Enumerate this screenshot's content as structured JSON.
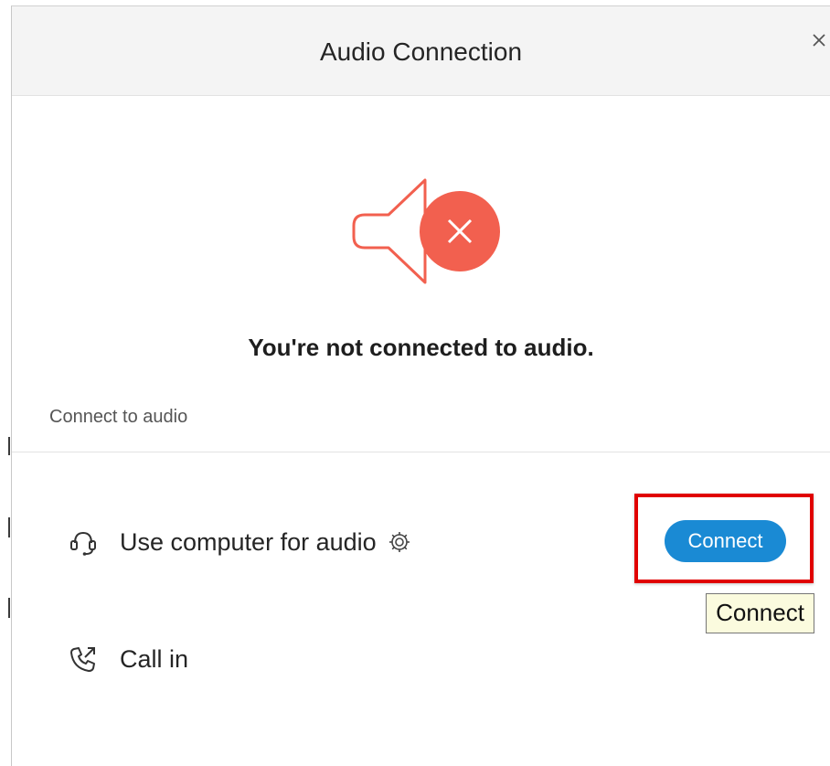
{
  "dialog": {
    "title": "Audio Connection",
    "close_icon": "close-icon"
  },
  "status": {
    "icon": "speaker-muted-icon",
    "message": "You're not connected to audio.",
    "colors": {
      "error_red": "#f2604f",
      "white": "#ffffff"
    }
  },
  "connect_section": {
    "label": "Connect to audio",
    "options": [
      {
        "icon": "headset-icon",
        "label": "Use computer for audio",
        "settings_icon": "gear-icon",
        "button_label": "Connect"
      },
      {
        "icon": "phone-call-icon",
        "label": "Call in"
      }
    ]
  },
  "tooltip": {
    "text": "Connect"
  },
  "colors": {
    "accent": "#1a8ad4",
    "highlight": "#e00000",
    "tooltip_bg": "#fbfbde"
  }
}
